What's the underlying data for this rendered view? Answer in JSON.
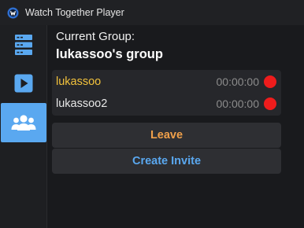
{
  "window": {
    "title": "Watch Together Player"
  },
  "sidebar": {
    "items": [
      {
        "icon": "server-list-icon",
        "active": false
      },
      {
        "icon": "play-icon",
        "active": false
      },
      {
        "icon": "group-users-icon",
        "active": true
      }
    ],
    "active_color": "#5aa8f0",
    "icon_color": "#5aa8f0"
  },
  "group": {
    "label": "Current Group:",
    "name": "lukassoo's group"
  },
  "members": [
    {
      "name": "lukassoo",
      "time": "00:00:00",
      "name_color": "#f2c23c",
      "status_color": "#ee1c1c"
    },
    {
      "name": "lukassoo2",
      "time": "00:00:00",
      "name_color": "#e8e8e8",
      "status_color": "#ee1c1c"
    }
  ],
  "actions": {
    "leave_label": "Leave",
    "leave_color": "#f0a04a",
    "invite_label": "Create Invite",
    "invite_color": "#5aa8f0"
  }
}
